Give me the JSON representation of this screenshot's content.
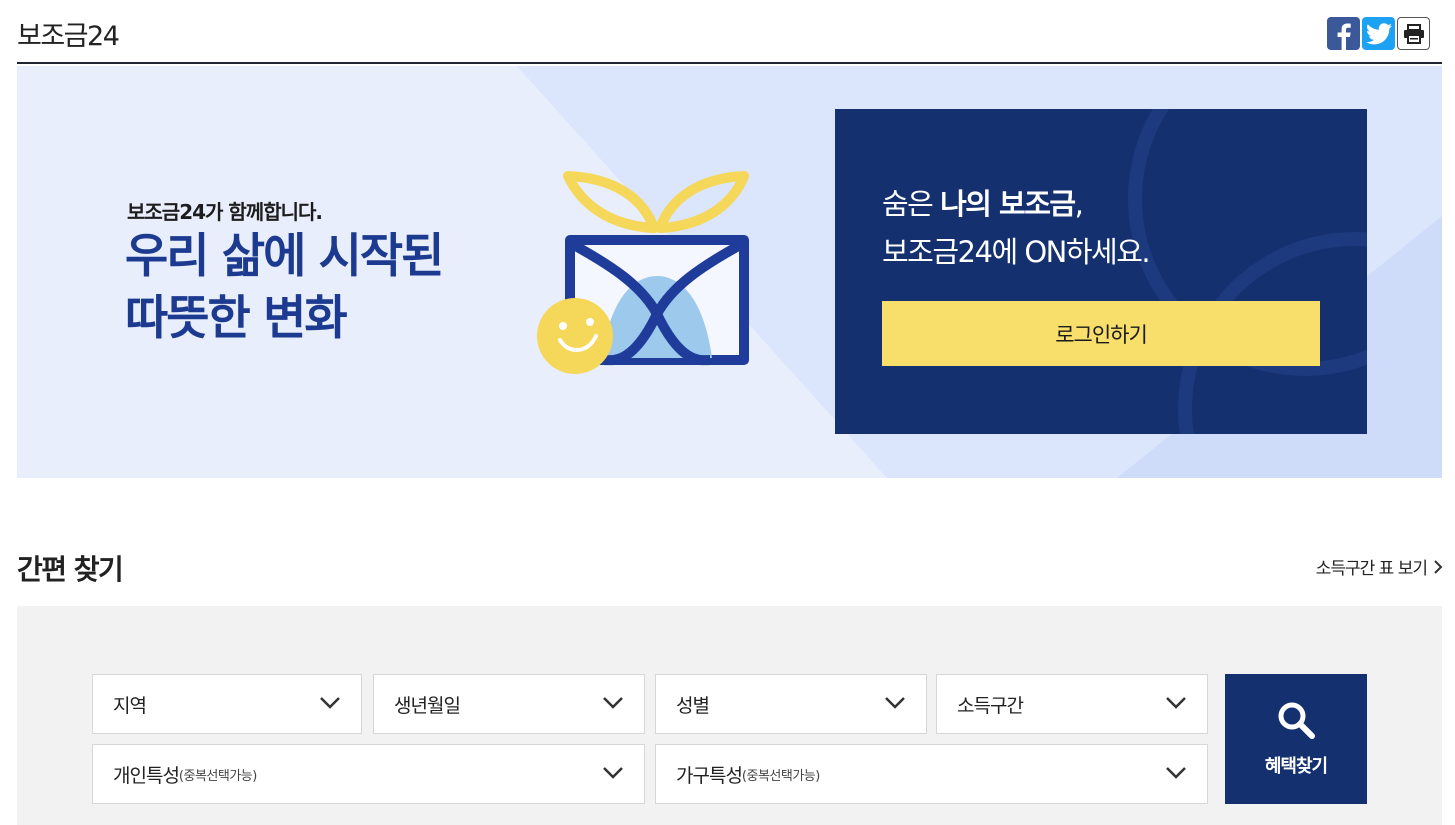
{
  "header": {
    "title": "보조금24",
    "share": [
      {
        "name": "facebook-icon"
      },
      {
        "name": "twitter-icon"
      },
      {
        "name": "print-icon"
      }
    ]
  },
  "hero": {
    "subtitle": "보조금24가 함께합니다.",
    "title_line1": "우리 삶에 시작된",
    "title_line2": "따뜻한 변화",
    "login_card": {
      "line1_prefix": "숨은 ",
      "line1_bold": "나의 보조금",
      "line1_suffix": ",",
      "line2": "보조금24에 ON하세요.",
      "button_label": "로그인하기"
    }
  },
  "quick_search": {
    "title": "간편 찾기",
    "income_link": "소득구간 표 보기",
    "filters": {
      "region": "지역",
      "birthdate": "생년월일",
      "gender": "성별",
      "income": "소득구간",
      "personal_label": "개인특성",
      "personal_note": "(중복선택가능)",
      "household_label": "가구특성",
      "household_note": "(중복선택가능)"
    },
    "search_button": "혜택찾기"
  },
  "colors": {
    "navy": "#14306f",
    "hero_bg": "#e8eefb",
    "hero_title": "#1c3a8f",
    "yellow": "#f8de6a",
    "panel_bg": "#f2f2f2"
  }
}
